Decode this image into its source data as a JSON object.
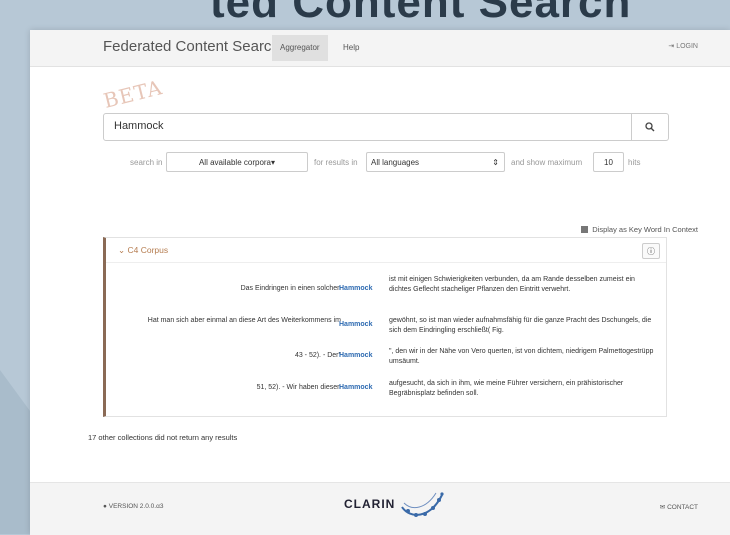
{
  "background_title": "ted Content Search",
  "nav": {
    "brand": "Federated Content Search",
    "tabs": [
      {
        "label": "Aggregator"
      },
      {
        "label": "Help"
      }
    ],
    "login": "LOGIN"
  },
  "beta_label": "BETA",
  "search": {
    "value": "Hammock",
    "button_icon": "search-icon"
  },
  "filters": {
    "search_in_label": "search in",
    "corpora_value": "All available corpora",
    "for_results_label": "for results in",
    "language_value": "All languages",
    "show_max_label": "and show maximum",
    "max_value": "10",
    "hits_label": "hits"
  },
  "kwic_toggle": "Display as Key Word In Context",
  "corpus": {
    "title": "C4 Corpus",
    "results": [
      {
        "left": "Das Eindringen in einen solchen",
        "keyword": "Hammock",
        "right": "ist mit einigen Schwierigkeiten verbunden, da am Rande desselben zumeist ein dichtes Geflecht stacheliger Pflanzen den Eintritt verwehrt."
      },
      {
        "left": "Hat man sich aber einmal an diese Art des Weiterkommens im",
        "keyword": "Hammock",
        "right": "gewöhnt, so ist man wieder aufnahmsfähig für die ganze Pracht des Dschungels, die sich dem Eindringling erschließt( Fig."
      },
      {
        "left": "43 - 52). - Der\"",
        "keyword": "Hammock",
        "right": "\", den wir in der Nähe von Vero querten, ist von dichtem, niedrigem Palmettogestrüpp umsäumt."
      },
      {
        "left": "51, 52). - Wir haben diesen",
        "keyword": "Hammock",
        "right": "aufgesucht, da sich in ihm, wie meine Führer versichern, ein prähistorischer Begräbnisplatz befinden soll."
      }
    ]
  },
  "no_results_text": "17 other collections did not return any results",
  "footer": {
    "version": "VERSION 2.0.0.α3",
    "logo_text": "CLARIN",
    "contact": "CONTACT"
  }
}
